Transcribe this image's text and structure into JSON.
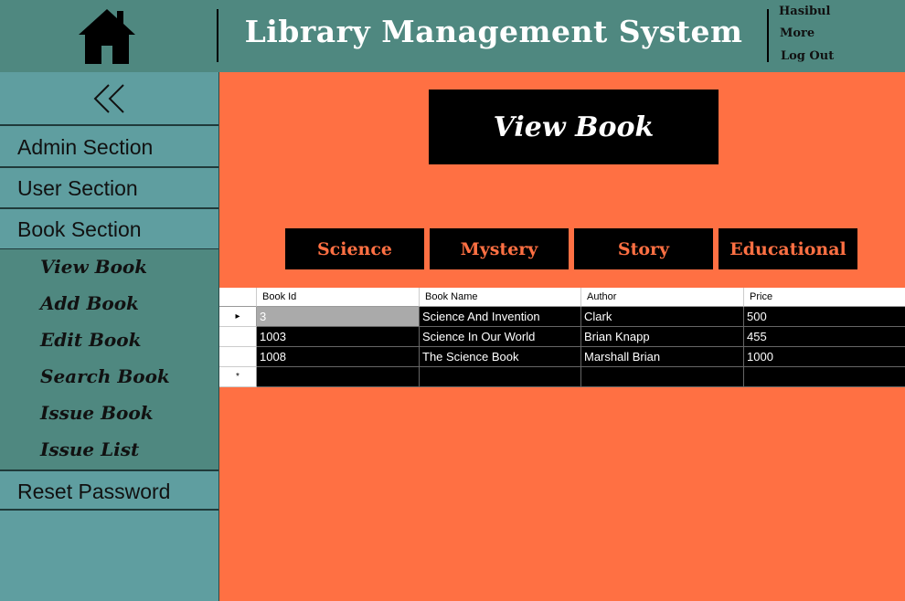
{
  "header": {
    "title": "Library Management System",
    "user_name": "Hasibul",
    "more_label": "More",
    "logout_label": "Log Out"
  },
  "sidebar": {
    "admin_label": "Admin Section",
    "user_label": "User Section",
    "book_label": "Book Section",
    "sub_items": [
      "View Book",
      "Add Book",
      "Edit Book",
      "Search Book",
      "Issue Book",
      "Issue List"
    ],
    "reset_label": "Reset Password"
  },
  "main": {
    "page_title": "View Book",
    "categories": [
      "Science",
      "Mystery",
      "Story",
      "Educational"
    ]
  },
  "table": {
    "columns": [
      "Book Id",
      "Book Name",
      "Author",
      "Price"
    ],
    "rows": [
      [
        "3",
        "Science And Invention",
        "Clark",
        "500"
      ],
      [
        "1003",
        "Science In Our World",
        "Brian Knapp",
        "455"
      ],
      [
        "1008",
        "The Science Book",
        "Marshall Brian",
        "1000"
      ]
    ],
    "current_row_marker": "▸",
    "new_row_marker": "*"
  },
  "colors": {
    "header_bg": "#4f8880",
    "sidebar_bg": "#5f9ea0",
    "main_bg": "#ff7043",
    "accent_text": "#ff7043"
  }
}
